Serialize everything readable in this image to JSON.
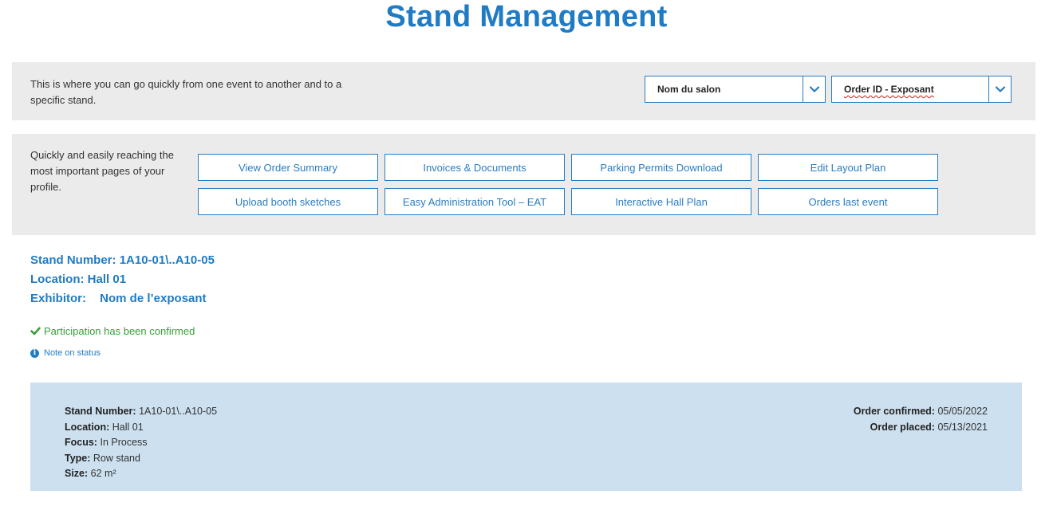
{
  "page": {
    "title": "Stand Management"
  },
  "event_bar": {
    "description": "This is where you can go quickly from one event to another and to a specific stand.",
    "event_select": {
      "value": "Nom du salon",
      "icon": "chevron-down-icon"
    },
    "order_select": {
      "value": "Order ID - Exposant",
      "icon": "chevron-down-icon"
    }
  },
  "quick_links": {
    "description": "Quickly and easily reaching the most important pages of your profile.",
    "buttons": [
      {
        "label": "View Order Summary"
      },
      {
        "label": "Invoices & Documents"
      },
      {
        "label": "Parking Permits Download"
      },
      {
        "label": "Edit Layout Plan"
      },
      {
        "label": "Upload booth sketches"
      },
      {
        "label": "Easy Administration Tool – EAT"
      },
      {
        "label": "Interactive Hall Plan"
      },
      {
        "label": "Orders last event"
      }
    ]
  },
  "stand": {
    "number_label": "Stand Number:",
    "number_value": "1A10-01\\..A10-05",
    "location_label": "Location:",
    "location_value": "Hall 01",
    "exhibitor_label": "Exhibitor:",
    "exhibitor_value": "Nom de l’exposant"
  },
  "status": {
    "confirmed_text": "Participation has been confirmed",
    "confirmed_icon": "checkmark-icon",
    "note_text": "Note on status",
    "note_icon": "info-icon"
  },
  "details": {
    "stand_number_label": "Stand Number:",
    "stand_number_value": "1A10-01\\..A10-05",
    "location_label": "Location:",
    "location_value": "Hall 01",
    "focus_label": "Focus:",
    "focus_value": "In Process",
    "type_label": "Type:",
    "type_value": "Row stand",
    "size_label": "Size:",
    "size_value": "62 m²",
    "order_confirmed_label": "Order confirmed:",
    "order_confirmed_value": "05/05/2022",
    "order_placed_label": "Order placed:",
    "order_placed_value": "05/13/2021"
  },
  "colors": {
    "accent": "#1f7bc4",
    "panel_gray": "#ebebeb",
    "panel_blue": "#cce0ef",
    "success": "#3a9d3a"
  }
}
